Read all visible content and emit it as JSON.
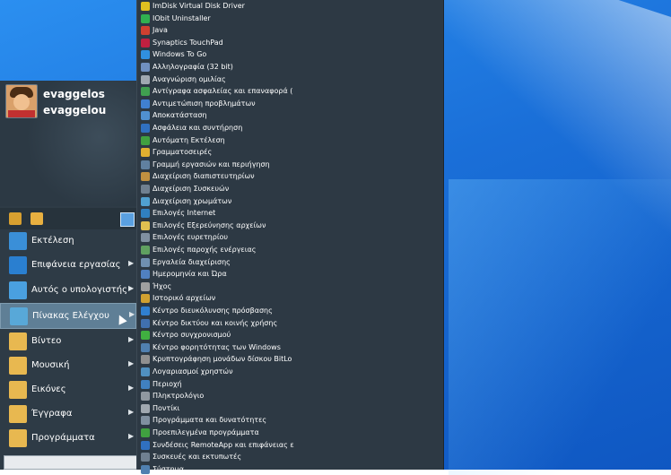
{
  "user": {
    "first": "evaggelos",
    "last": "evaggelou"
  },
  "start_menu": {
    "items": [
      {
        "label": "Εκτέλεση",
        "icon": "run-icon",
        "color": "#3a8fd8",
        "arrow": ""
      },
      {
        "label": "Επιφάνεια εργασίας",
        "icon": "desktop-icon",
        "color": "#2a7fd0",
        "arrow": "▶"
      },
      {
        "label": "Αυτός ο υπολογιστής",
        "icon": "computer-icon",
        "color": "#4aa0e0",
        "arrow": "▶"
      },
      {
        "label": "Πίνακας Ελέγχου",
        "icon": "control-panel-icon",
        "color": "#58a8d8",
        "arrow": "▶"
      },
      {
        "label": "Βίντεο",
        "icon": "folder-icon",
        "color": "#e8b850",
        "arrow": "▶"
      },
      {
        "label": "Μουσική",
        "icon": "folder-icon",
        "color": "#e8b850",
        "arrow": "▶"
      },
      {
        "label": "Εικόνες",
        "icon": "folder-icon",
        "color": "#e8b850",
        "arrow": "▶"
      },
      {
        "label": "Έγγραφα",
        "icon": "folder-icon",
        "color": "#e8b850",
        "arrow": "▶"
      },
      {
        "label": "Προγράμματα",
        "icon": "folder-icon",
        "color": "#e8b850",
        "arrow": "▶"
      }
    ]
  },
  "submenu": {
    "items": [
      {
        "label": "ImDisk Virtual Disk Driver",
        "color": "#e0c020"
      },
      {
        "label": "IObit Uninstaller",
        "color": "#30b050"
      },
      {
        "label": "Java",
        "color": "#d04030"
      },
      {
        "label": "Synaptics TouchPad",
        "color": "#c02040"
      },
      {
        "label": "Windows To Go",
        "color": "#3090e0"
      },
      {
        "label": "Αλληλογραφία (32 bit)",
        "color": "#7090c0"
      },
      {
        "label": "Αναγνώριση ομιλίας",
        "color": "#a0a8b0"
      },
      {
        "label": "Αντίγραφα ασφαλείας και επαναφορά (",
        "color": "#40a050"
      },
      {
        "label": "Αντιμετώπιση προβλημάτων",
        "color": "#4080d0"
      },
      {
        "label": "Αποκατάσταση",
        "color": "#5090d0"
      },
      {
        "label": "Ασφάλεια και συντήρηση",
        "color": "#3070c0"
      },
      {
        "label": "Αυτόματη Εκτέλεση",
        "color": "#40a040"
      },
      {
        "label": "Γραμματοσειρές",
        "color": "#e0b030"
      },
      {
        "label": "Γραμμή εργασιών και περιήγηση",
        "color": "#6080a0"
      },
      {
        "label": "Διαχείριση διαπιστευτηρίων",
        "color": "#c09040"
      },
      {
        "label": "Διαχείριση Συσκευών",
        "color": "#708090"
      },
      {
        "label": "Διαχείριση χρωμάτων",
        "color": "#50a0d0"
      },
      {
        "label": "Επιλογές Internet",
        "color": "#3080c0"
      },
      {
        "label": "Επιλογές Εξερεύνησης αρχείων",
        "color": "#e0c050"
      },
      {
        "label": "Επιλογές ευρετηρίου",
        "color": "#8090a0"
      },
      {
        "label": "Επιλογές παροχής ενέργειας",
        "color": "#60a060"
      },
      {
        "label": "Εργαλεία διαχείρισης",
        "color": "#7090b0"
      },
      {
        "label": "Ημερομηνία και Ώρα",
        "color": "#5080c0"
      },
      {
        "label": "Ήχος",
        "color": "#a0a0a0"
      },
      {
        "label": "Ιστορικό αρχείων",
        "color": "#d0a030"
      },
      {
        "label": "Κέντρο διευκόλυνσης πρόσβασης",
        "color": "#3080d0"
      },
      {
        "label": "Κέντρο δικτύου και κοινής χρήσης",
        "color": "#4070b0"
      },
      {
        "label": "Κέντρο συγχρονισμού",
        "color": "#40b040"
      },
      {
        "label": "Κέντρο φορητότητας των Windows",
        "color": "#5080b0"
      },
      {
        "label": "Κρυπτογράφηση μονάδων δίσκου BitLo",
        "color": "#909090"
      },
      {
        "label": "Λογαριασμοί χρηστών",
        "color": "#5090c0"
      },
      {
        "label": "Περιοχή",
        "color": "#4080c0"
      },
      {
        "label": "Πληκτρολόγιο",
        "color": "#9098a0"
      },
      {
        "label": "Ποντίκι",
        "color": "#a0a8b0"
      },
      {
        "label": "Προγράμματα και δυνατότητες",
        "color": "#8090a0"
      },
      {
        "label": "Προεπιλεγμένα προγράμματα",
        "color": "#40a040"
      },
      {
        "label": "Συνδέσεις RemoteApp και επιφάνειας ε",
        "color": "#3070c0"
      },
      {
        "label": "Συσκευές και εκτυπωτές",
        "color": "#708090"
      },
      {
        "label": "Σύστημα",
        "color": "#5080b0"
      }
    ]
  }
}
